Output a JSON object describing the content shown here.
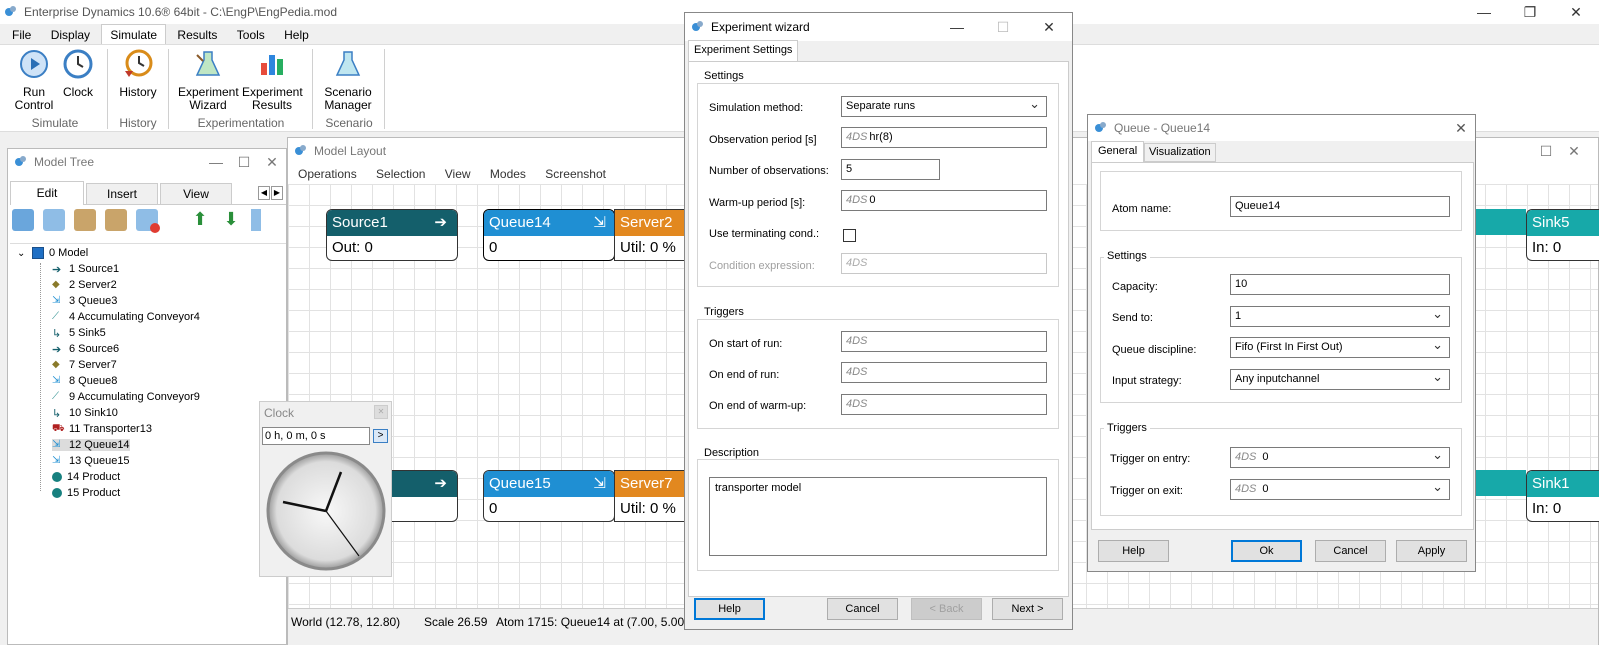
{
  "app": {
    "title": "Enterprise Dynamics 10.6® 64bit -  C:\\EngP\\EngPedia.mod"
  },
  "menu": [
    "File",
    "Display",
    "Simulate",
    "Results",
    "Tools",
    "Help"
  ],
  "ribbon": {
    "buttons": [
      "Run\nControl",
      "Clock",
      "History",
      "Experiment\nWizard",
      "Experiment\nResults",
      "Scenario\nManager"
    ],
    "groups": [
      "Simulate",
      "History",
      "Experimentation",
      "Scenario"
    ]
  },
  "model_tree": {
    "title": "Model Tree",
    "tabs": [
      "Edit",
      "Insert",
      "View"
    ],
    "root": "0 Model",
    "items": [
      "1 Source1",
      "2 Server2",
      "3 Queue3",
      "4 Accumulating Conveyor4",
      "5 Sink5",
      "6 Source6",
      "7 Server7",
      "8 Queue8",
      "9 Accumulating Conveyor9",
      "10 Sink10",
      "11 Transporter13",
      "12 Queue14",
      "13 Queue15",
      "14 Product",
      "15 Product"
    ]
  },
  "clock": {
    "title": "Clock",
    "time": "0 h, 0 m, 0 s",
    "go": ">"
  },
  "layout": {
    "title": "Model Layout",
    "menu": [
      "Operations",
      "Selection",
      "View",
      "Modes",
      "Screenshot"
    ],
    "atoms": [
      {
        "name": "Source1",
        "value": "Out: 0"
      },
      {
        "name": "Queue14",
        "value": "0"
      },
      {
        "name": "Server2",
        "value": "Util: 0 %"
      },
      {
        "name": "",
        "value": ""
      },
      {
        "name": "Queue15",
        "value": "0"
      },
      {
        "name": "Server7",
        "value": "Util: 0 %"
      },
      {
        "name": "Sink5",
        "value": "In: 0"
      },
      {
        "name": "Sink1",
        "value": "In: 0"
      }
    ],
    "status": {
      "world": "World (12.78, 12.80)",
      "scale": "Scale 26.59",
      "atom": "Atom 1715: Queue14 at (7.00, 5.00, 0"
    }
  },
  "wizard": {
    "title": "Experiment wizard",
    "tab": "Experiment Settings",
    "settings_title": "Settings",
    "sim_method_label": "Simulation method:",
    "sim_method": "Separate runs",
    "obs_period_label": "Observation period [s]",
    "obs_period": "hr(8)",
    "num_obs_label": "Number of observations:",
    "num_obs": "5",
    "warmup_label": "Warm-up period [s]:",
    "warmup": "0",
    "use_term_label": "Use terminating cond.:",
    "cond_expr_label": "Condition expression:",
    "triggers_title": "Triggers",
    "on_start_label": "On start of run:",
    "on_end_label": "On end of run:",
    "on_end_warmup_label": "On end of warm-up:",
    "prefix": "4DS",
    "description_title": "Description",
    "description": "transporter model",
    "buttons": {
      "help": "Help",
      "cancel": "Cancel",
      "back": "< Back",
      "next": "Next >"
    }
  },
  "queue": {
    "title": "Queue - Queue14",
    "tabs": [
      "General",
      "Visualization"
    ],
    "atom_name_label": "Atom name:",
    "atom_name": "Queue14",
    "settings_title": "Settings",
    "capacity_label": "Capacity:",
    "capacity": "10",
    "send_to_label": "Send to:",
    "send_to": "1",
    "discipline_label": "Queue discipline:",
    "discipline": "Fifo (First In First Out)",
    "input_label": "Input strategy:",
    "input": "Any inputchannel",
    "triggers_title": "Triggers",
    "entry_label": "Trigger on entry:",
    "entry": "0",
    "exit_label": "Trigger on exit:",
    "exit": "0",
    "prefix": "4DS",
    "buttons": {
      "help": "Help",
      "ok": "Ok",
      "cancel": "Cancel",
      "apply": "Apply"
    }
  },
  "colors": {
    "source": "#145f6b",
    "queue": "#1f8fd3",
    "server": "#e2881f",
    "sink": "#17a9a9"
  }
}
